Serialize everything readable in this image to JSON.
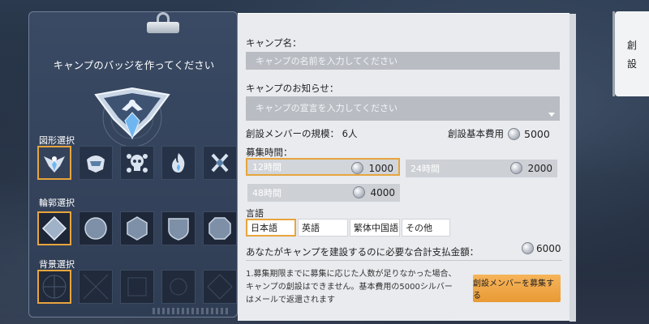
{
  "left": {
    "title": "キャンプのバッジを作ってください",
    "shape_label": "図形選択",
    "frame_label": "輪郭選択",
    "background_label": "背景選択",
    "shapes": [
      "eagle-emblem-icon",
      "shark-emblem-icon",
      "skull-emblem-icon",
      "flame-emblem-icon",
      "crossed-blades-icon"
    ],
    "frames": [
      "diamond-frame-icon",
      "circle-frame-icon",
      "hexagon-frame-icon",
      "shield-frame-icon",
      "octagon-frame-icon"
    ]
  },
  "form": {
    "camp_name_label": "キャンプ名：",
    "camp_name_placeholder": "キャンプの名前を入力してください",
    "notice_label": "キャンプのお知らせ：",
    "notice_placeholder": "キャンプの宣言を入力してください",
    "scale_label": "創設メンバーの規模：",
    "scale_value": "6人",
    "base_fee_label": "創設基本費用",
    "base_fee_value": "5000",
    "recruit_time_label": "募集時間：",
    "durations": [
      {
        "label": "12時間",
        "cost": "1000"
      },
      {
        "label": "24時間",
        "cost": "2000"
      },
      {
        "label": "48時間",
        "cost": "4000"
      }
    ],
    "language_label": "言語",
    "languages": [
      "日本語",
      "英語",
      "繁体中国語",
      "その他"
    ],
    "total_label": "あなたがキャンプを建設するのに必要な合計支払金額：",
    "total_value": "6000",
    "note_line1": "1.募集期限までに募集に応じた人数が足りなかった場合、",
    "note_line2": "キャンプの創設はできません。基本費用の5000シルバー",
    "note_line3": "はメールで返還されます",
    "recruit_button": "創設メンバーを募集する"
  },
  "side_tab": {
    "char1": "創",
    "char2": "設"
  },
  "colors": {
    "accent": "#e7a53e",
    "panel": "#2f3d54",
    "form_bg": "#e9ebee"
  }
}
